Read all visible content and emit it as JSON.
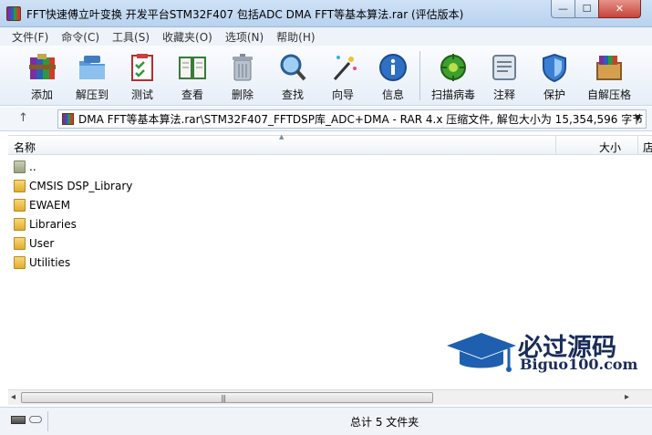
{
  "window": {
    "title": "FFT快速傅立叶变换 开发平台STM32F407 包括ADC DMA FFT等基本算法.rar (评估版本)",
    "controls": {
      "minimize": "—",
      "maximize": "☐",
      "close": "✕"
    }
  },
  "menubar": {
    "items": [
      "文件(F)",
      "命令(C)",
      "工具(S)",
      "收藏夹(O)",
      "选项(N)",
      "帮助(H)"
    ]
  },
  "toolbar": {
    "buttons": [
      {
        "label": "添加",
        "icon": "add-archive-icon"
      },
      {
        "label": "解压到",
        "icon": "extract-folder-icon"
      },
      {
        "label": "测试",
        "icon": "test-checklist-icon"
      },
      {
        "label": "查看",
        "icon": "view-book-icon"
      },
      {
        "label": "删除",
        "icon": "trash-icon"
      },
      {
        "label": "查找",
        "icon": "find-magnifier-icon"
      },
      {
        "label": "向导",
        "icon": "wizard-wand-icon"
      },
      {
        "label": "信息",
        "icon": "info-icon"
      },
      {
        "label": "扫描病毒",
        "icon": "virus-scan-icon"
      },
      {
        "label": "注释",
        "icon": "comment-icon"
      },
      {
        "label": "保护",
        "icon": "shield-icon"
      },
      {
        "label": "自解压格",
        "icon": "sfx-box-icon"
      }
    ]
  },
  "address": {
    "up_label": "↑",
    "path": "DMA FFT等基本算法.rar\\STM32F407_FFTDSP库_ADC+DMA - RAR 4.x 压缩文件, 解包大小为 15,354,596 字节",
    "dropdown": "▼"
  },
  "list": {
    "columns": {
      "name": "名称",
      "size": "大小",
      "type": "店"
    },
    "sort_indicator": "▲",
    "items": [
      {
        "name": "..",
        "kind": "parent-folder"
      },
      {
        "name": "CMSIS DSP_Library",
        "kind": "folder"
      },
      {
        "name": "EWAEM",
        "kind": "folder"
      },
      {
        "name": "Libraries",
        "kind": "folder"
      },
      {
        "name": "User",
        "kind": "folder"
      },
      {
        "name": "Utilities",
        "kind": "folder"
      }
    ]
  },
  "scrollbar": {
    "left": "◂",
    "right": "▸",
    "grip": "|||"
  },
  "status": {
    "summary": "总计 5 文件夹"
  },
  "watermark": {
    "title": "必过源码",
    "url": "Biguo100.com"
  },
  "colors": {
    "accent": "#1a2c58",
    "folder": "#e2ad2e",
    "title_bg": "#cfe2f6"
  }
}
